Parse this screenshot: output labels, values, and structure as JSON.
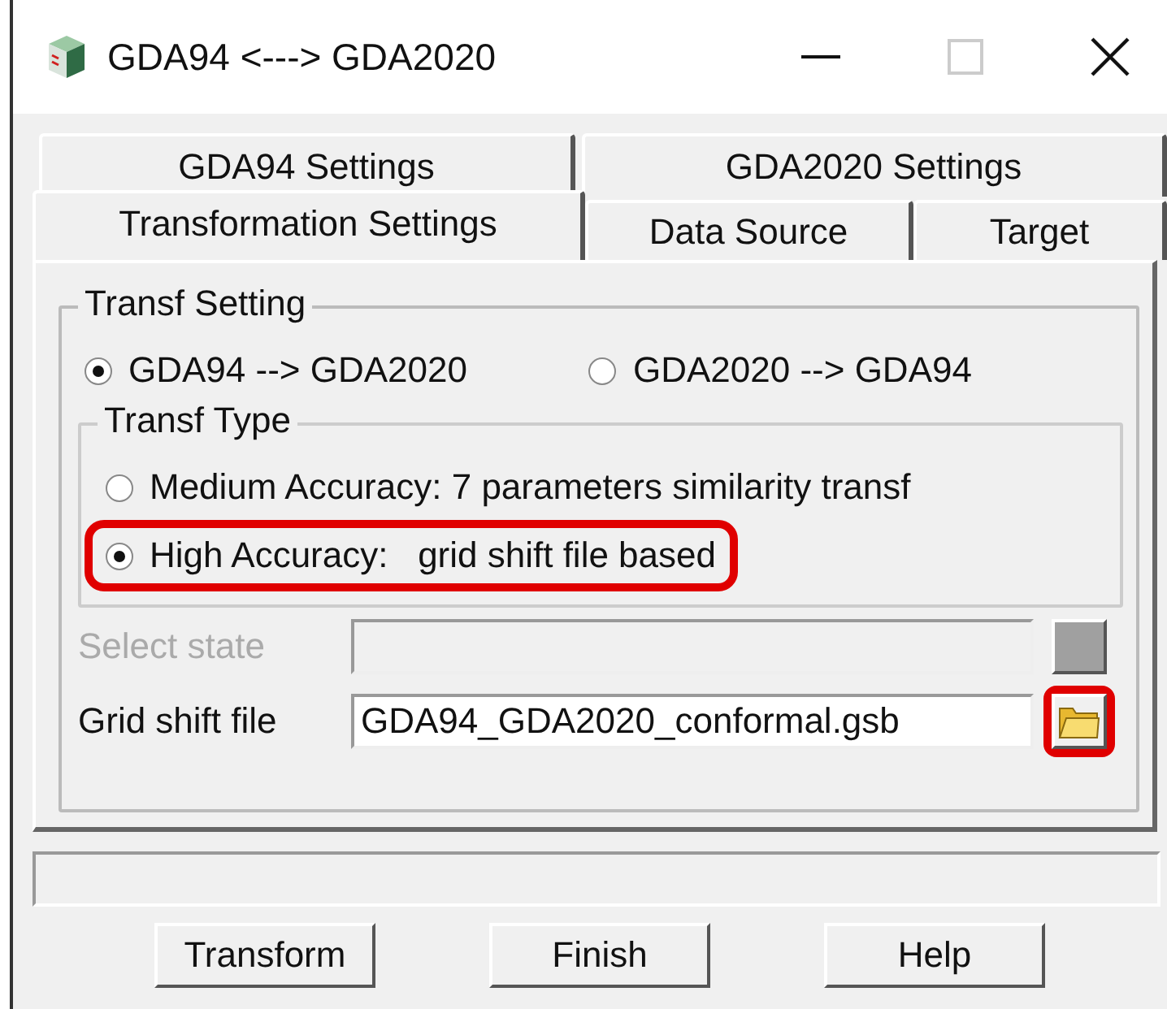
{
  "window": {
    "title": "GDA94 <---> GDA2020"
  },
  "tab_rows": [
    {
      "tabs": [
        {
          "label": "GDA94 Settings",
          "selected": false
        },
        {
          "label": "GDA2020 Settings",
          "selected": false
        }
      ]
    },
    {
      "tabs": [
        {
          "label": "Transformation Settings",
          "selected": true
        },
        {
          "label": "Data Source",
          "selected": false
        },
        {
          "label": "Target",
          "selected": false
        }
      ]
    }
  ],
  "transf_setting": {
    "title": "Transf Setting",
    "options": [
      {
        "label": "GDA94 --> GDA2020",
        "selected": true
      },
      {
        "label": "GDA2020 --> GDA94",
        "selected": false
      }
    ],
    "transf_type": {
      "title": "Transf Type",
      "options": [
        {
          "label": "Medium Accuracy: 7 parameters similarity transf",
          "selected": false,
          "highlighted": false
        },
        {
          "label": "High Accuracy:   grid shift file based",
          "selected": true,
          "highlighted": true
        }
      ]
    },
    "fields": [
      {
        "label": "Select state",
        "disabled": true,
        "kind": "swatch",
        "highlighted": false
      },
      {
        "label": "Grid shift file",
        "disabled": false,
        "value": "GDA94_GDA2020_conformal.gsb",
        "kind": "folder",
        "highlighted": true
      }
    ]
  },
  "buttons": [
    "Transform",
    "Finish",
    "Help"
  ]
}
